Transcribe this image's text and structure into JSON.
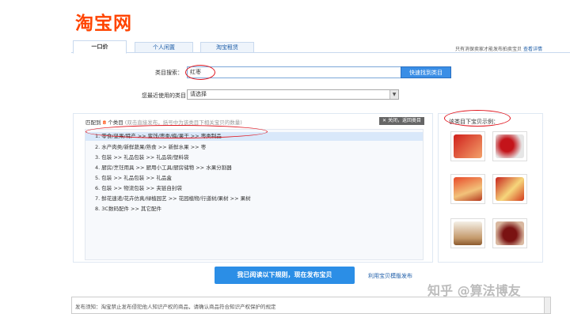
{
  "brand": {
    "logo_text": "淘宝网"
  },
  "tabs": [
    {
      "label": "一口价"
    },
    {
      "label": "个人闲置"
    },
    {
      "label": "淘宝租赁"
    }
  ],
  "tab_note": {
    "text": "只有消保卖家才能发布拍卖宝贝",
    "link": "查看详情"
  },
  "search": {
    "label": "类目搜索：",
    "value": "红枣",
    "button": "快速找到类目"
  },
  "recent": {
    "label": "您最近使用的类目：",
    "value": "请选择"
  },
  "results": {
    "prefix": "匹配到",
    "count": "8",
    "suffix": "个类目",
    "hint": "(双击直接发布，括号中为该类目下相关宝贝的数量)",
    "close": "关闭，返回类目",
    "items": [
      "1.  零食/坚果/特产 >> 蜜饯/枣类/梅/果干 >> 枣类制品",
      "2.  水产肉类/新鲜蔬果/熟食 >> 新鲜水果 >> 枣",
      "3.  包装 >> 礼品包装 >> 礼品袋/塑料袋",
      "4.  厨房/烹饪用具 >> 厨用小工具/厨房储物 >> 水果分割器",
      "5.  包装 >> 礼品包装 >> 礼品盒",
      "6.  包装 >> 物流包装 >> 夹链自封袋",
      "7.  鲜花速递/花卉仿真/绿植园艺 >> 花园植物/行道树/果树 >> 果树",
      "8.  3C数码配件 >> 其它配件"
    ]
  },
  "sample": {
    "title": "该类目下宝贝示例："
  },
  "actions": {
    "publish": "我已阅读以下规则，现在发布宝贝",
    "template": "利用宝贝模版发布"
  },
  "notice": {
    "text": "发布须知：淘宝禁止发布侵犯他人知识产权的商品，请确认商品符合知识产权保护的规定"
  },
  "watermark": {
    "text": "知乎 @算法博友"
  },
  "colors": {
    "brand": "#ff4400",
    "link": "#1f5ea8",
    "button": "#2b8ee6",
    "highlight": "#e0161f"
  }
}
